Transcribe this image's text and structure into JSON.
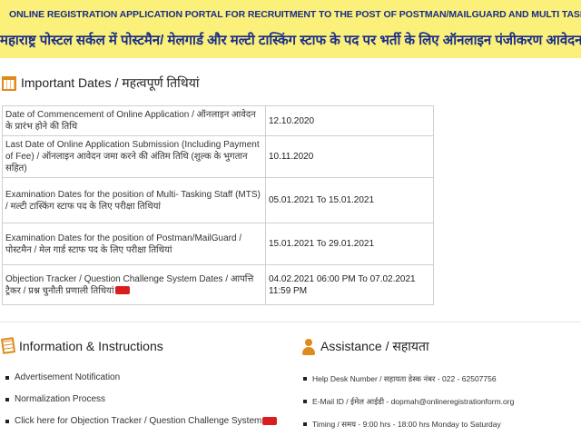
{
  "banner": {
    "title_en": "ONLINE REGISTRATION APPLICATION PORTAL FOR RECRUITMENT TO THE POST OF POSTMAN/MAILGUARD AND MULTI TASKING STAFF IN MAHARASHTRA POSTAL CIRCLE",
    "title_hi": "महाराष्ट्र पोस्टल सर्कल में पोस्टमैन/ मेलगार्ड और मल्टी टास्किंग स्टाफ के पद पर भर्ती के लिए ऑनलाइन पंजीकरण आवेदन पोर्टल"
  },
  "important_dates": {
    "heading": "Important Dates / महत्वपूर्ण तिथियां",
    "rows": [
      {
        "label": "Date of Commencement of Online Application / ऑनलाइन आवेदन के प्रारंभ होने की तिथि",
        "value": "12.10.2020"
      },
      {
        "label": "Last Date of Online Application Submission (Including Payment of Fee) / ऑनलाइन आवेदन जमा करने की अंतिम तिथि (शुल्क के भुगतान सहित)",
        "value": "10.11.2020"
      },
      {
        "label": "Examination Dates for the position of Multi- Tasking Staff (MTS) / मल्टी टास्किंग स्टाफ पद के लिए परीक्षा तिथियां",
        "value": "05.01.2021 To 15.01.2021"
      },
      {
        "label": "Examination Dates for the position of Postman/MailGuard / पोस्टमैन / मेल गार्ड स्टाफ पद के लिए परीक्षा तिथियां",
        "value": "15.01.2021 To 29.01.2021"
      },
      {
        "label": "Objection Tracker / Question Challenge System Dates / आपत्ति ट्रैकर / प्रश्न चुनौती प्रणाली तिथियां",
        "value": "04.02.2021 06:00 PM To 07.02.2021 11:59 PM"
      }
    ]
  },
  "information": {
    "heading": "Information & Instructions",
    "items": [
      "Advertisement Notification",
      "Normalization Process",
      "Click here for Objection Tracker / Question Challenge System"
    ]
  },
  "assistance": {
    "heading": "Assistance / सहायता",
    "items": [
      "Help Desk Number / सहायता डेस्क नंबर - 022 - 62507756",
      "E-Mail ID / ईमेल आईडी - dopmah@onlineregistrationform.org",
      "Timing / समय - 9:00 hrs - 18:00 hrs Monday to Saturday"
    ]
  },
  "colors": {
    "banner_bg": "#fbf07a",
    "banner_text": "#1a2d8a",
    "icon_accent": "#e08a1b",
    "highlight_red": "#d81e1e"
  }
}
